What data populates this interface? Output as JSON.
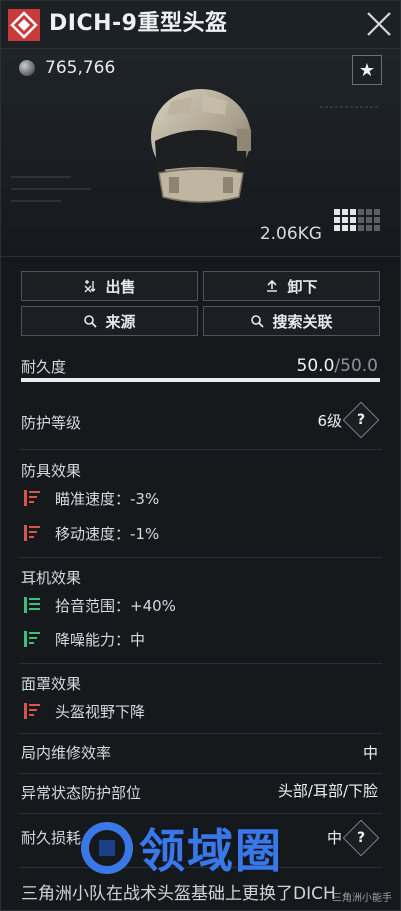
{
  "header": {
    "title": "DICH-9重型头盔"
  },
  "hero": {
    "currency_value": "765,766",
    "weight": "2.06KG"
  },
  "actions": {
    "sell": "出售",
    "unequip": "卸下",
    "source": "来源",
    "search_related": "搜索关联"
  },
  "durability": {
    "label": "耐久度",
    "current": "50.0",
    "max": "/50.0",
    "fraction": 1.0
  },
  "protection_level": {
    "label": "防护等级",
    "value": "6级"
  },
  "armor_effects": {
    "title": "防具效果",
    "items": [
      {
        "text": "瞄准速度：-3%",
        "kind": "negative"
      },
      {
        "text": "移动速度：-1%",
        "kind": "negative"
      }
    ]
  },
  "headset_effects": {
    "title": "耳机效果",
    "items": [
      {
        "text": "拾音范围：+40%",
        "kind": "positive"
      },
      {
        "text": "降噪能力：中",
        "kind": "positive"
      }
    ]
  },
  "mask_effects": {
    "title": "面罩效果",
    "items": [
      {
        "text": "头盔视野下降",
        "kind": "negative"
      }
    ]
  },
  "repair_efficiency": {
    "label": "局内维修效率",
    "value": "中"
  },
  "status_protection": {
    "label": "异常状态防护部位",
    "value": "头部/耳部/下脸"
  },
  "durability_loss": {
    "label": "耐久损耗",
    "value": "中"
  },
  "description": "三角洲小队在战术头盔基础上更换了DICH",
  "watermark": {
    "text": "领域圈",
    "credit": "三角洲小能手"
  },
  "colors": {
    "negative": "#d9544f",
    "positive": "#3fbf7f",
    "accent": "#d64545"
  }
}
